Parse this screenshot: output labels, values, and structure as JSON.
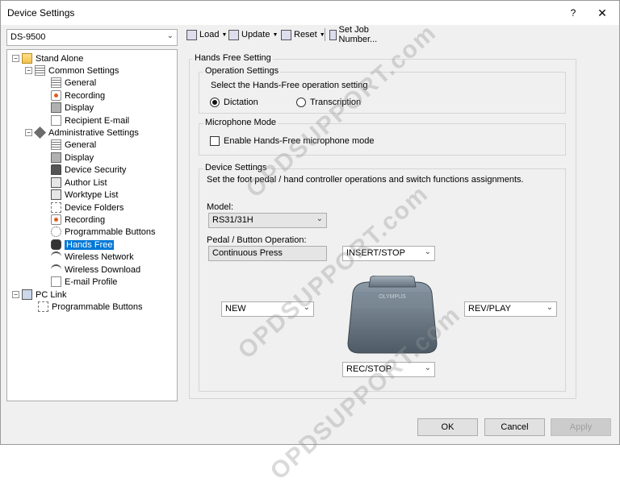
{
  "window": {
    "title": "Device Settings",
    "help": "?",
    "close": "✕"
  },
  "device_select": {
    "value": "DS-9500"
  },
  "toolbar": {
    "load": "Load",
    "update": "Update",
    "reset": "Reset",
    "set_job": "Set Job Number..."
  },
  "tree": {
    "stand_alone": "Stand Alone",
    "common_settings": "Common Settings",
    "general": "General",
    "recording": "Recording",
    "display": "Display",
    "recipient_email": "Recipient E-mail",
    "admin_settings": "Administrative Settings",
    "general2": "General",
    "display2": "Display",
    "device_security": "Device Security",
    "author_list": "Author List",
    "worktype_list": "Worktype List",
    "device_folders": "Device Folders",
    "recording2": "Recording",
    "programmable_buttons": "Programmable Buttons",
    "hands_free": "Hands Free",
    "wireless_network": "Wireless Network",
    "wireless_download": "Wireless Download",
    "email_profile": "E-mail Profile",
    "pc_link": "PC Link",
    "pc_programmable_buttons": "Programmable Buttons"
  },
  "panel": {
    "hands_free_setting": "Hands Free Setting",
    "operation_settings": "Operation Settings",
    "select_text": "Select the Hands-Free operation setting",
    "dictation": "Dictation",
    "transcription": "Transcription",
    "microphone_mode": "Microphone Mode",
    "enable_mic": "Enable Hands-Free microphone mode",
    "device_settings": "Device Settings",
    "device_desc": "Set the foot pedal / hand controller operations and switch functions assignments.",
    "model_label": "Model:",
    "model_value": "RS31/31H",
    "pedal_label": "Pedal / Button Operation:",
    "pedal_value": "Continuous Press",
    "top_combo": "INSERT/STOP",
    "left_combo": "NEW",
    "right_combo": "REV/PLAY",
    "bottom_combo": "REC/STOP",
    "pedal_brand": "OLYMPUS"
  },
  "buttons": {
    "ok": "OK",
    "cancel": "Cancel",
    "apply": "Apply"
  },
  "watermark": "OPDSUPPORT.com"
}
